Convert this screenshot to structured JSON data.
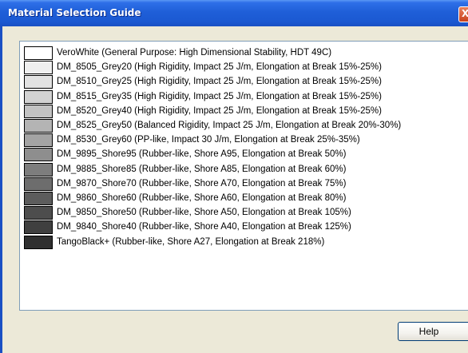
{
  "window": {
    "title": "Material Selection Guide",
    "close_glyph": "X"
  },
  "materials": [
    {
      "label": "VeroWhite (General Purpose: High Dimensional Stability, HDT 49C)",
      "color": "#ffffff"
    },
    {
      "label": "DM_8505_Grey20 (High Rigidity, Impact 25 J/m, Elongation at Break 15%-25%)",
      "color": "#efefef"
    },
    {
      "label": "DM_8510_Grey25 (High Rigidity, Impact 25 J/m, Elongation at Break 15%-25%)",
      "color": "#e2e2e2"
    },
    {
      "label": "DM_8515_Grey35 (High Rigidity, Impact 25 J/m, Elongation at Break 15%-25%)",
      "color": "#d2d2d2"
    },
    {
      "label": "DM_8520_Grey40 (High Rigidity, Impact 25 J/m, Elongation at Break 15%-25%)",
      "color": "#c3c3c3"
    },
    {
      "label": "DM_8525_Grey50 (Balanced Rigidity, Impact 25 J/m, Elongation at Break 20%-30%)",
      "color": "#b4b4b4"
    },
    {
      "label": "DM_8530_Grey60 (PP-like, Impact 30 J/m, Elongation at Break 25%-35%)",
      "color": "#a4a4a4"
    },
    {
      "label": "DM_9895_Shore95 (Rubber-like, Shore A95, Elongation at Break 50%)",
      "color": "#8e8e8e"
    },
    {
      "label": "DM_9885_Shore85 (Rubber-like, Shore A85, Elongation at Break 60%)",
      "color": "#7d7d7d"
    },
    {
      "label": "DM_9870_Shore70 (Rubber-like, Shore A70, Elongation at Break 75%)",
      "color": "#6d6d6d"
    },
    {
      "label": "DM_9860_Shore60 (Rubber-like, Shore A60, Elongation at Break 80%)",
      "color": "#5c5c5c"
    },
    {
      "label": "DM_9850_Shore50 (Rubber-like, Shore A50, Elongation at Break 105%)",
      "color": "#4d4d4d"
    },
    {
      "label": "DM_9840_Shore40 (Rubber-like, Shore A40, Elongation at Break 125%)",
      "color": "#3f3f3f"
    },
    {
      "label": "TangoBlack+ (Rubber-like, Shore A27, Elongation at Break 218%)",
      "color": "#2f2f2f"
    }
  ],
  "buttons": {
    "help_label": "Help"
  },
  "icons": {
    "close": "close-icon"
  }
}
